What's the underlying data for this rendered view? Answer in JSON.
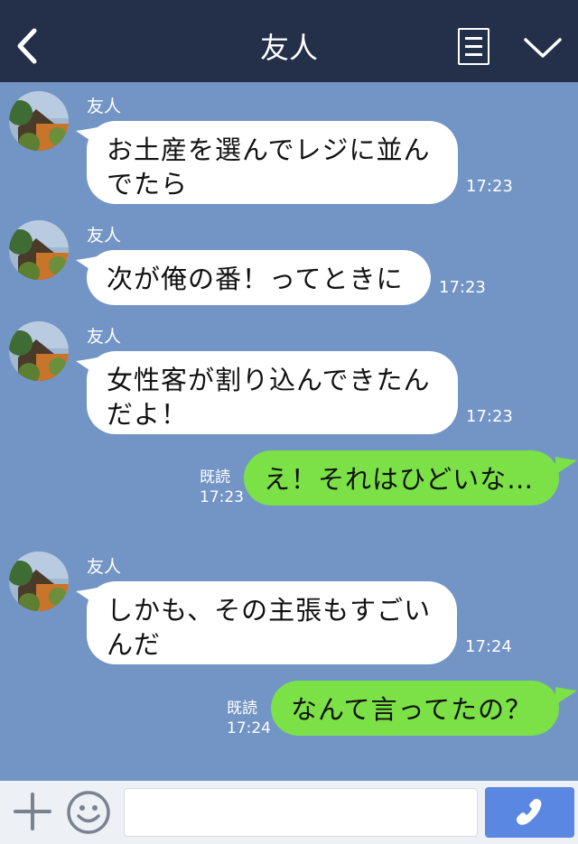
{
  "header": {
    "title": "友人"
  },
  "messages": [
    {
      "sender": "友人",
      "lines": [
        "お土産を選んでレジに並ん",
        "でたら"
      ],
      "time": "17:23"
    },
    {
      "sender": "友人",
      "lines": [
        "次が俺の番！ってときに"
      ],
      "time": "17:23"
    },
    {
      "sender": "友人",
      "lines": [
        "女性客が割り込んできたん",
        "だよ！"
      ],
      "time": "17:23"
    },
    {
      "outgoing": true,
      "lines": [
        "え！それはひどいな…"
      ],
      "read_label": "既読",
      "time": "17:23"
    },
    {
      "sender": "友人",
      "lines": [
        "しかも、その主張もすごい",
        "んだ"
      ],
      "time": "17:24"
    },
    {
      "outgoing": true,
      "lines": [
        "なんて言ってたの？"
      ],
      "read_label": "既読",
      "time": "17:24"
    }
  ],
  "input": {
    "placeholder": ""
  },
  "colors": {
    "background": "#7395c5",
    "header": "#243049",
    "outgoing_bubble": "#7be146",
    "incoming_bubble": "#ffffff",
    "call_button": "#5a87e2"
  },
  "icons": [
    "back-arrow-icon",
    "menu-icon",
    "chevron-down-icon",
    "plus-icon",
    "emoji-icon",
    "phone-icon"
  ]
}
